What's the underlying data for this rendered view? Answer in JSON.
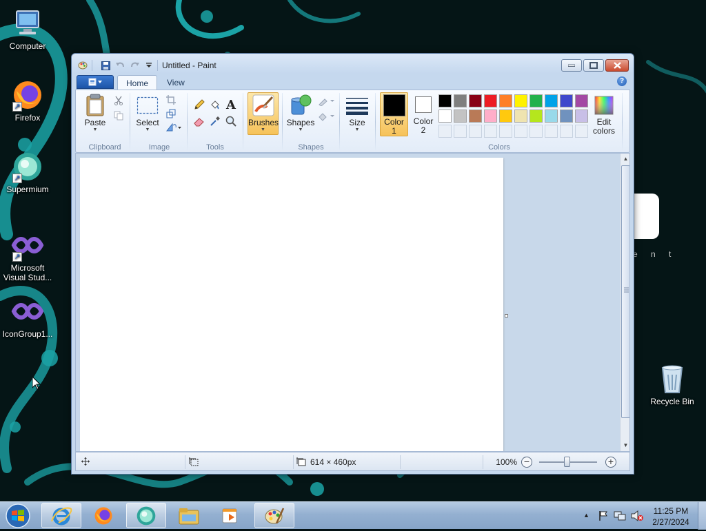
{
  "desktop": {
    "icons": [
      {
        "label": "Computer"
      },
      {
        "label": "Firefox"
      },
      {
        "label": "Supermium"
      },
      {
        "label": "Microsoft Visual Stud..."
      },
      {
        "label": "IconGroup1..."
      },
      {
        "label": "Recycle Bin"
      }
    ],
    "background_logo_text": "e n t"
  },
  "window": {
    "title": "Untitled - Paint",
    "tabs": [
      {
        "label": "Home",
        "selected": true
      },
      {
        "label": "View",
        "selected": false
      }
    ]
  },
  "ribbon": {
    "groups": {
      "clipboard": "Clipboard",
      "image": "Image",
      "tools": "Tools",
      "shapes": "Shapes",
      "colors": "Colors"
    },
    "buttons": {
      "paste": "Paste",
      "select": "Select",
      "brushes": "Brushes",
      "shapes": "Shapes",
      "size": "Size",
      "color1_line1": "Color",
      "color1_line2": "1",
      "color2_line1": "Color",
      "color2_line2": "2",
      "edit_colors_line1": "Edit",
      "edit_colors_line2": "colors"
    },
    "color1": "#000000",
    "color2": "#ffffff",
    "palette_row1": [
      "#000000",
      "#7f7f7f",
      "#880015",
      "#ed1c24",
      "#ff7f27",
      "#fff200",
      "#22b14c",
      "#00a2e8",
      "#3f48cc",
      "#a349a4"
    ],
    "palette_row2": [
      "#ffffff",
      "#c3c3c3",
      "#b97a57",
      "#ffaec9",
      "#ffc90e",
      "#efe4b0",
      "#b5e61d",
      "#99d9ea",
      "#7092be",
      "#c8bfe7"
    ]
  },
  "status": {
    "canvas_size": "614 × 460px",
    "zoom": "100%"
  },
  "taskbar": {
    "time": "11:25 PM",
    "date": "2/27/2024"
  }
}
